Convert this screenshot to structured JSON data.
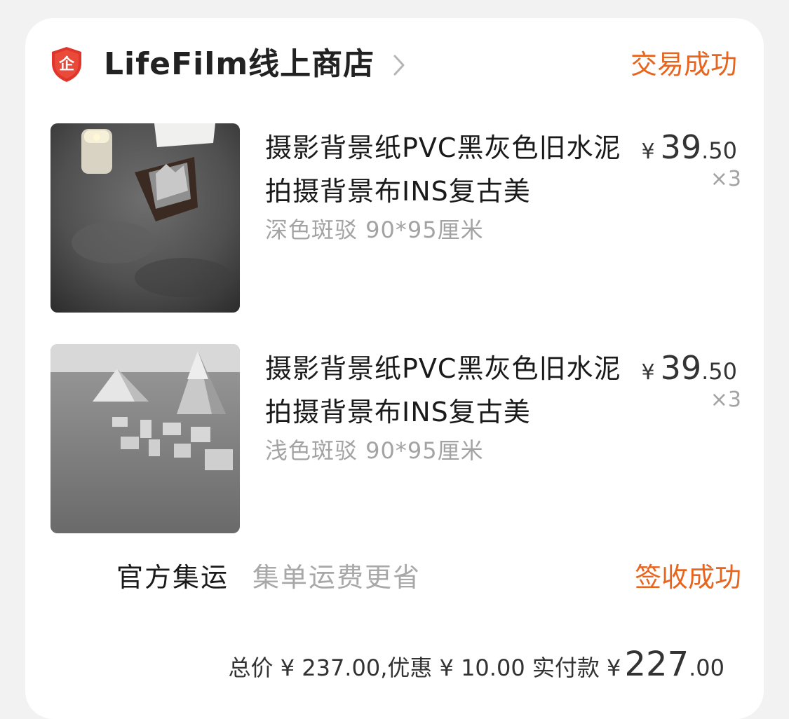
{
  "shop": {
    "badge_icon": "enterprise-shield-icon",
    "name": "LifeFilm线上商店",
    "status": "交易成功",
    "accent_color": "#e9641d"
  },
  "items": [
    {
      "title": "摄影背景纸PVC黑灰色旧水泥拍摄背景布INS复古美",
      "spec": "深色斑驳 90*95厘米",
      "price_symbol": "¥",
      "price_int": "39",
      "price_dec": ".50",
      "quantity": "×3",
      "image": "dark-concrete-product-photo"
    },
    {
      "title": "摄影背景纸PVC黑灰色旧水泥拍摄背景布INS复古美",
      "spec": "浅色斑驳 90*95厘米",
      "price_symbol": "¥",
      "price_int": "39",
      "price_dec": ".50",
      "quantity": "×3",
      "image": "light-concrete-product-photo"
    }
  ],
  "shipping": {
    "label": "官方集运",
    "desc": "集单运费更省",
    "status": "签收成功"
  },
  "summary": {
    "total_text": "总价 ¥ 237.00,优惠 ¥ 10.00 实付款 ¥",
    "paid_int": "227",
    "paid_dec": ".00"
  }
}
